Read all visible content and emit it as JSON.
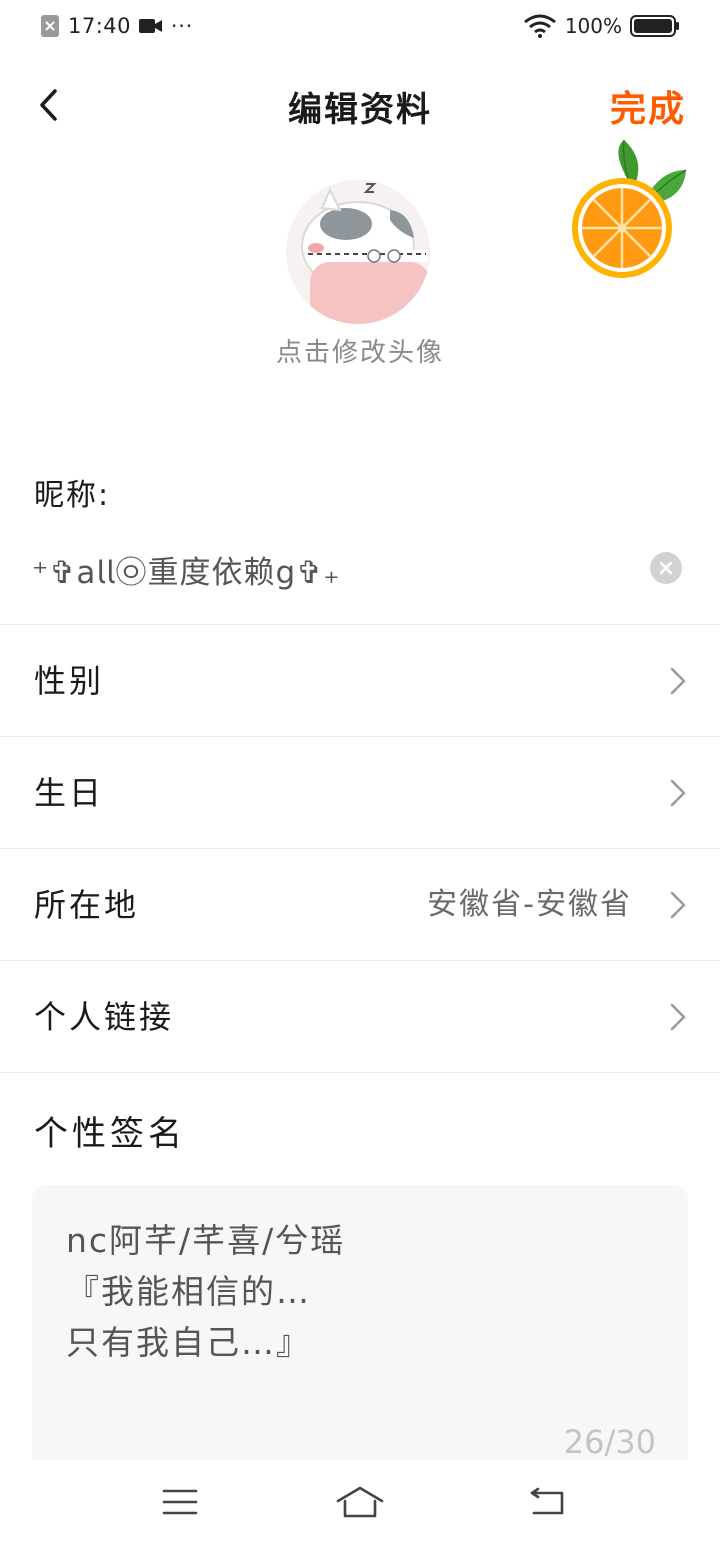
{
  "status_bar": {
    "time": "17:40",
    "more": "···",
    "battery_percent": "100%",
    "battery_level": 1.0,
    "icons": [
      "notification-muted-icon",
      "video-icon",
      "wifi-icon",
      "battery-icon"
    ]
  },
  "header": {
    "back_icon": "chevron-left-icon",
    "title": "编辑资料",
    "done_label": "完成",
    "accent_color": "#ff5a00"
  },
  "avatar": {
    "hint": "点击修改头像"
  },
  "nickname": {
    "label": "昵称:",
    "value": "⁺✞𝖺𝗅𝗅㉧重度依赖𝗀✞₊"
  },
  "rows": [
    {
      "label": "性别",
      "value": ""
    },
    {
      "label": "生日",
      "value": ""
    },
    {
      "label": "所在地",
      "value": "安徽省-安徽省"
    },
    {
      "label": "个人链接",
      "value": ""
    }
  ],
  "signature": {
    "label": "个性签名",
    "text": "nc阿芊/芊喜/兮瑶\n『我能相信的…\n只有我自己…』",
    "count": "26/30"
  },
  "nav": {
    "items": [
      "menu-icon",
      "home-icon",
      "back-icon"
    ]
  }
}
